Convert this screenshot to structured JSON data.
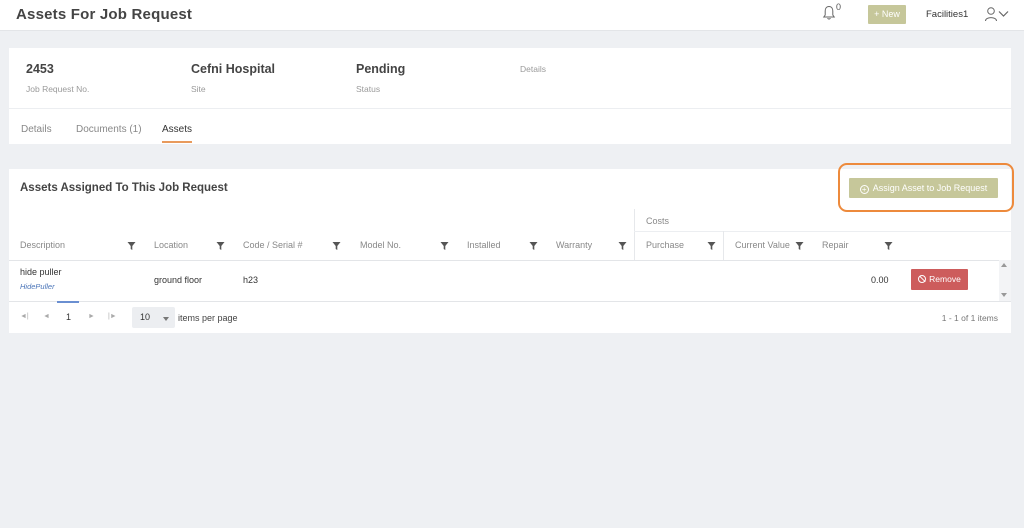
{
  "app": {
    "title": "Assets For Job Request",
    "notification_count": "0",
    "new_label": "+ New",
    "user_name": "Facilities1"
  },
  "job": {
    "number": "2453",
    "number_label": "Job Request No.",
    "site": "Cefni Hospital",
    "site_label": "Site",
    "status": "Pending",
    "status_label": "Status",
    "details_label": "Details"
  },
  "tabs": [
    {
      "label": "Details",
      "active": false
    },
    {
      "label": "Documents (1)",
      "active": false
    },
    {
      "label": "Assets",
      "active": true
    }
  ],
  "assets": {
    "section_title": "Assets Assigned To This Job Request",
    "assign_button": "Assign Asset to Job Request",
    "costs_group": "Costs",
    "columns": [
      "Description",
      "Location",
      "Code / Serial #",
      "Model No.",
      "Installed",
      "Warranty",
      "Purchase",
      "Current Value",
      "Repair"
    ],
    "rows": [
      {
        "description": "hide puller",
        "asset_link": "HidePuller",
        "location": "ground floor",
        "code": "h23",
        "model": "",
        "installed": "",
        "warranty": "",
        "purchase": "",
        "current_value": "",
        "repair": "0.00",
        "remove_label": "Remove"
      }
    ]
  },
  "pager": {
    "current_page": "1",
    "page_size": "10",
    "per_page_label": "items per page",
    "summary": "1 - 1 of 1 items"
  },
  "colors": {
    "accent_button": "#c6c79a",
    "remove_button": "#cd5c5c",
    "highlight_ring": "#ed8a3c",
    "active_tab_underline": "#e89a5c"
  }
}
